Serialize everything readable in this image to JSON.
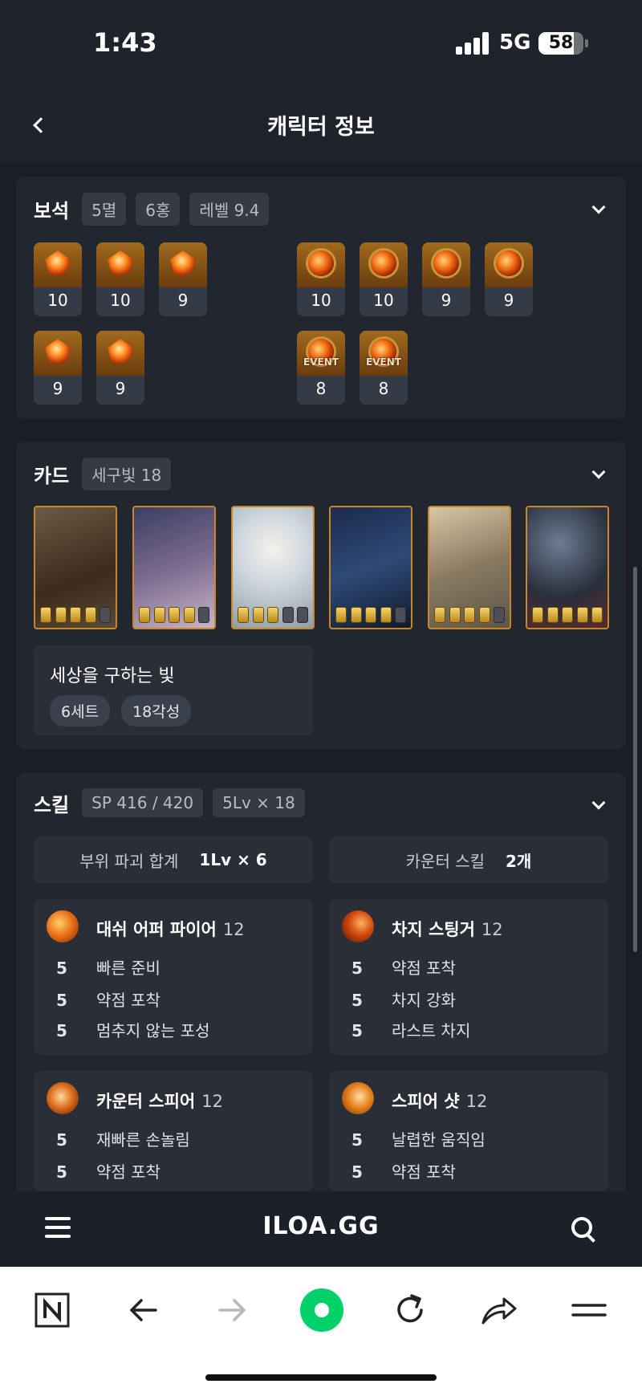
{
  "status": {
    "time": "1:43",
    "network": "5G",
    "battery": "58"
  },
  "header": {
    "title": "캐릭터 정보"
  },
  "gems": {
    "title": "보석",
    "tags": [
      "5멸",
      "6홍",
      "레벨 9.4"
    ],
    "damage": [
      "10",
      "10",
      "9",
      "9",
      "9"
    ],
    "cooldown": [
      "10",
      "10",
      "9",
      "9",
      "8",
      "8"
    ],
    "event_label": "EVENT"
  },
  "cards": {
    "title": "카드",
    "tag": "세구빛 18",
    "card_awakenings": [
      4,
      4,
      3,
      4,
      4,
      5
    ],
    "set": {
      "name": "세상을 구하는 빛",
      "sets": "6세트",
      "awaken": "18각성"
    }
  },
  "skills": {
    "title": "스킬",
    "tags": [
      "SP 416 / 420",
      "5Lv × 18"
    ],
    "summary": [
      {
        "label": "부위 파괴 합계",
        "value": "1Lv × 6"
      },
      {
        "label": "카운터 스킬",
        "value": "2개"
      }
    ],
    "list": [
      {
        "name": "대쉬 어퍼 파이어",
        "level": "12",
        "tripods": [
          {
            "lv": "5",
            "name": "빠른 준비"
          },
          {
            "lv": "5",
            "name": "약점 포착"
          },
          {
            "lv": "5",
            "name": "멈추지 않는 포성"
          }
        ]
      },
      {
        "name": "차지 스팅거",
        "level": "12",
        "tripods": [
          {
            "lv": "5",
            "name": "약점 포착"
          },
          {
            "lv": "5",
            "name": "차지 강화"
          },
          {
            "lv": "5",
            "name": "라스트 차지"
          }
        ]
      },
      {
        "name": "카운터 스피어",
        "level": "12",
        "tripods": [
          {
            "lv": "5",
            "name": "재빠른 손놀림"
          },
          {
            "lv": "5",
            "name": "약점 포착"
          }
        ]
      },
      {
        "name": "스피어 샷",
        "level": "12",
        "tripods": [
          {
            "lv": "5",
            "name": "날렵한 움직임"
          },
          {
            "lv": "5",
            "name": "약점 포착"
          }
        ]
      }
    ]
  },
  "site": {
    "logo": "ILOA.GG"
  },
  "colors": {
    "background": "#1b1e25",
    "card": "#22262e",
    "accent": "#00d26a",
    "card_border": "#c7862c"
  }
}
